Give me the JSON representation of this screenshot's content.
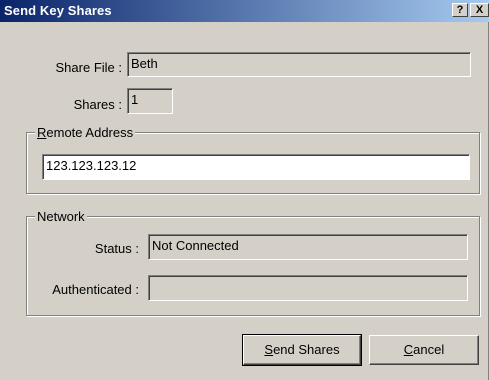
{
  "window": {
    "title": "Send Key Shares",
    "help_glyph": "?",
    "close_glyph": "X"
  },
  "share_file": {
    "label": "Share File :",
    "value": "Beth"
  },
  "shares": {
    "label": "Shares :",
    "value": "1"
  },
  "remote_address": {
    "group_title_first": "R",
    "group_title_rest": "emote Address",
    "value": "123.123.123.12"
  },
  "network": {
    "group_title": "Network",
    "status_label": "Status :",
    "status_value": "Not Connected",
    "authenticated_label": "Authenticated :",
    "authenticated_value": ""
  },
  "buttons": {
    "send_first": "S",
    "send_rest": "end Shares",
    "cancel_first": "C",
    "cancel_rest": "ancel"
  }
}
